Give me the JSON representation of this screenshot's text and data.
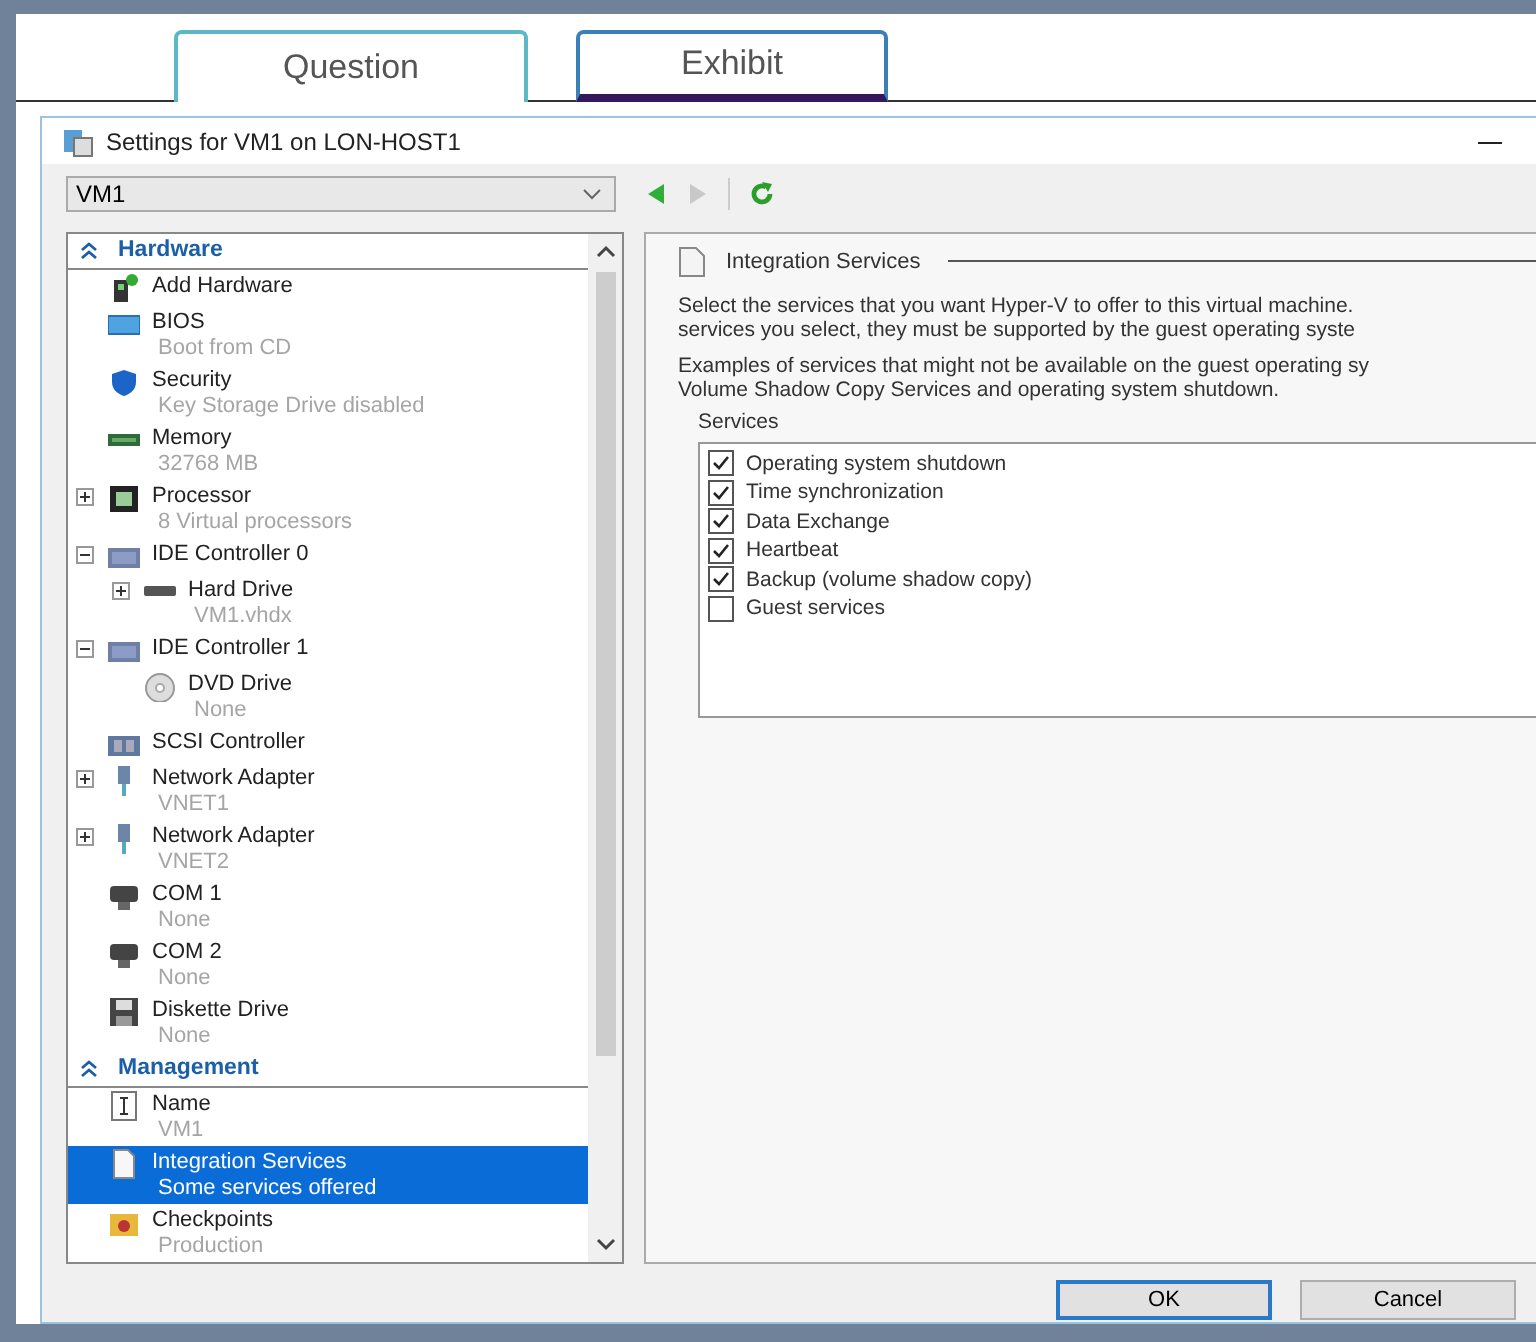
{
  "tabs": [
    {
      "label": "Question",
      "selected": false
    },
    {
      "label": "Exhibit",
      "selected": true
    }
  ],
  "window": {
    "title": "Settings for VM1 on LON-HOST1"
  },
  "vm_selector": {
    "value": "VM1"
  },
  "toolbar": {
    "back_disabled": false,
    "forward_disabled": true
  },
  "tree": {
    "sections": [
      {
        "label": "Hardware",
        "expanded": true,
        "items": [
          {
            "kind": "add_hardware",
            "label": "Add Hardware",
            "selected": false
          },
          {
            "kind": "bios",
            "label": "BIOS",
            "detail": "Boot from CD",
            "selected": false
          },
          {
            "kind": "security",
            "label": "Security",
            "detail": "Key Storage Drive disabled",
            "selected": false
          },
          {
            "kind": "memory",
            "label": "Memory",
            "detail": "32768 MB",
            "selected": false
          },
          {
            "kind": "processor",
            "label": "Processor",
            "detail": "8 Virtual processors",
            "expanded": false,
            "selected": false
          },
          {
            "kind": "ide",
            "label": "IDE Controller 0",
            "expanded": true,
            "selected": false,
            "children": [
              {
                "kind": "hard_drive",
                "label": "Hard Drive",
                "detail": "VM1.vhdx",
                "expanded": false,
                "selected": false
              }
            ]
          },
          {
            "kind": "ide",
            "label": "IDE Controller 1",
            "expanded": true,
            "selected": false,
            "children": [
              {
                "kind": "dvd",
                "label": "DVD Drive",
                "detail": "None",
                "selected": false
              }
            ]
          },
          {
            "kind": "scsi",
            "label": "SCSI Controller",
            "selected": false
          },
          {
            "kind": "network",
            "label": "Network Adapter",
            "detail": "VNET1",
            "expanded": false,
            "selected": false
          },
          {
            "kind": "network",
            "label": "Network Adapter",
            "detail": "VNET2",
            "expanded": false,
            "selected": false
          },
          {
            "kind": "com",
            "label": "COM 1",
            "detail": "None",
            "selected": false
          },
          {
            "kind": "com",
            "label": "COM 2",
            "detail": "None",
            "selected": false
          },
          {
            "kind": "diskette",
            "label": "Diskette Drive",
            "detail": "None",
            "selected": false
          }
        ]
      },
      {
        "label": "Management",
        "expanded": true,
        "items": [
          {
            "kind": "name",
            "label": "Name",
            "detail": "VM1",
            "selected": false
          },
          {
            "kind": "integration",
            "label": "Integration Services",
            "detail": "Some services offered",
            "selected": true
          },
          {
            "kind": "checkpoints",
            "label": "Checkpoints",
            "detail": "Production",
            "selected": false
          }
        ]
      }
    ]
  },
  "detail_panel": {
    "title": "Integration Services",
    "paragraphs": [
      [
        "Select the services that you want Hyper-V to offer to this virtual machine.",
        "services you select, they must be supported by the guest operating syste"
      ],
      [
        "Examples of services that might not be available on the guest operating sy",
        "Volume Shadow Copy Services and operating system shutdown."
      ]
    ],
    "services_label": "Services",
    "services": [
      {
        "label": "Operating system shutdown",
        "checked": true
      },
      {
        "label": "Time synchronization",
        "checked": true
      },
      {
        "label": "Data Exchange",
        "checked": true
      },
      {
        "label": "Heartbeat",
        "checked": true
      },
      {
        "label": "Backup (volume shadow copy)",
        "checked": true
      },
      {
        "label": "Guest services",
        "checked": false
      }
    ]
  },
  "buttons": [
    {
      "label": "OK",
      "default": true
    },
    {
      "label": "Cancel",
      "default": false
    }
  ]
}
